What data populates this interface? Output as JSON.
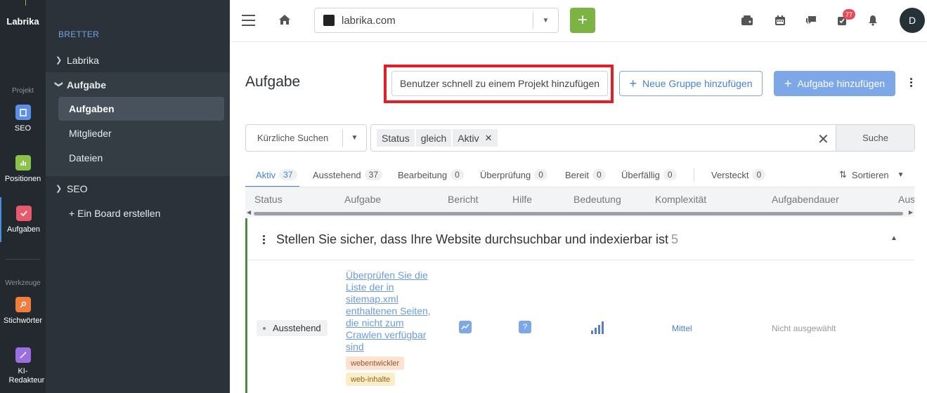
{
  "rail": {
    "logo": "Labrika",
    "section_project": "Projekt",
    "section_tools": "Werkzeuge",
    "items": [
      {
        "label": "SEO",
        "color": "#5c8fe6"
      },
      {
        "label": "Positionen",
        "color": "#8bc34a"
      },
      {
        "label": "Aufgaben",
        "color": "#e85a6b"
      },
      {
        "label": "Stichwörter",
        "color": "#ef7d3c"
      },
      {
        "label": "KI-Redakteur",
        "color": "#9b6fe0"
      }
    ]
  },
  "nav": {
    "title": "BRETTER",
    "items": [
      {
        "label": "Labrika"
      },
      {
        "label": "Aufgabe"
      },
      {
        "label": "SEO"
      },
      {
        "label": "+ Ein Board erstellen"
      }
    ],
    "subitems": [
      {
        "label": "Aufgaben"
      },
      {
        "label": "Mitglieder"
      },
      {
        "label": "Dateien"
      }
    ]
  },
  "header": {
    "site": "labrika.com",
    "notification_count": "77",
    "avatar_initial": "D",
    "accent": "#7cb342"
  },
  "main": {
    "title": "Aufgabe",
    "btn_quick_add_user": "Benutzer schnell zu einem Projekt hinzufügen",
    "btn_new_group": "Neue Gruppe hinzufügen",
    "btn_add_task": "Aufgabe hinzufügen",
    "recent_searches": "Kürzliche Suchen",
    "filter_chips": [
      "Status",
      "gleich",
      "Aktiv"
    ],
    "search_btn": "Suche",
    "tabs": [
      {
        "label": "Aktiv",
        "count": "37"
      },
      {
        "label": "Ausstehend",
        "count": "37"
      },
      {
        "label": "Bearbeitung",
        "count": "0"
      },
      {
        "label": "Überprüfung",
        "count": "0"
      },
      {
        "label": "Bereit",
        "count": "0"
      },
      {
        "label": "Überfällig",
        "count": "0"
      },
      {
        "label": "Versteckt",
        "count": "0"
      }
    ],
    "sort_label": "Sortieren",
    "columns": [
      "Status",
      "Aufgabe",
      "Bericht",
      "Hilfe",
      "Bedeutung",
      "Komplexität",
      "Aufgabendauer",
      "Aus"
    ],
    "group": {
      "title": "Stellen Sie sicher, dass Ihre Website durchsuchbar und indexierbar ist",
      "count": "5"
    },
    "row": {
      "status": "Ausstehend",
      "task": "Überprüfen Sie die Liste der in sitemap.xml enthaltenen Seiten, die nicht zum Crawlen verfügbar sind",
      "tags": [
        "webentwickler",
        "web-inhalte"
      ],
      "help_icon": "?",
      "importance_icon": "signal-bars-icon",
      "complexity": "Mittel",
      "duration": "Nicht ausgewählt"
    }
  }
}
